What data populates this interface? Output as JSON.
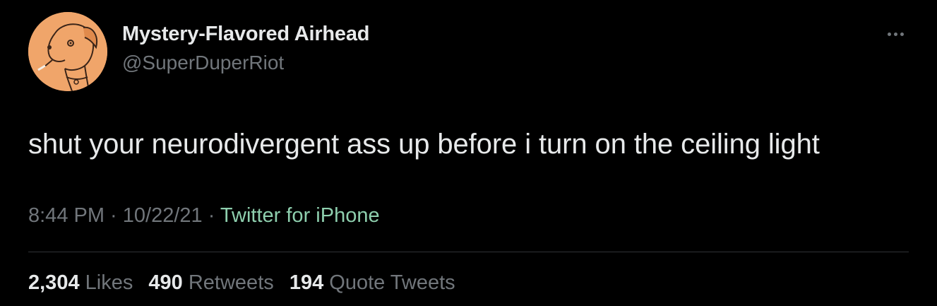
{
  "author": {
    "display_name": "Mystery-Flavored Airhead",
    "handle": "@SuperDuperRiot",
    "avatar_icon": "cartoon-dog-avatar"
  },
  "tweet": {
    "text": "shut your neurodivergent ass up before i turn on the ceiling light"
  },
  "meta": {
    "time": "8:44 PM",
    "separator1": " · ",
    "date": "10/22/21",
    "separator2": " · ",
    "source": "Twitter for iPhone"
  },
  "stats": {
    "likes_count": "2,304",
    "likes_label": "Likes",
    "retweets_count": "490",
    "retweets_label": "Retweets",
    "quotes_count": "194",
    "quotes_label": "Quote Tweets"
  },
  "colors": {
    "background": "#000000",
    "primary_text": "#e7e9ea",
    "secondary_text": "#71767b",
    "source_link": "#8ecfae",
    "divider": "#2f3336",
    "avatar_bg": "#f0a56a"
  }
}
